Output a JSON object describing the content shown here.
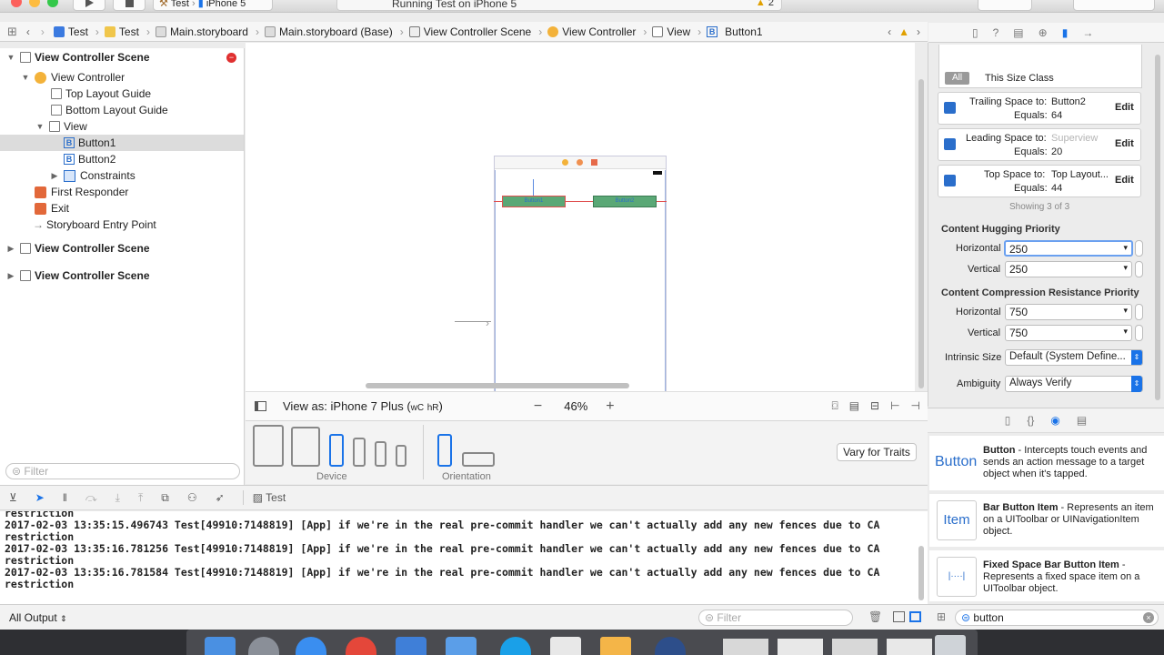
{
  "toolbar": {
    "scheme_target": "Test",
    "scheme_device": "iPhone 5",
    "status_text": "Running Test on iPhone 5",
    "warning_count": "2"
  },
  "jumpbar": [
    "Test",
    "Test",
    "Main.storyboard",
    "Main.storyboard (Base)",
    "View Controller Scene",
    "View Controller",
    "View",
    "Button1"
  ],
  "navigator": {
    "items": [
      {
        "label": "View Controller Scene",
        "bold": true
      },
      {
        "label": "View Controller"
      },
      {
        "label": "Top Layout Guide"
      },
      {
        "label": "Bottom Layout Guide"
      },
      {
        "label": "View"
      },
      {
        "label": "Button1"
      },
      {
        "label": "Button2"
      },
      {
        "label": "Constraints"
      },
      {
        "label": "First Responder"
      },
      {
        "label": "Exit"
      },
      {
        "label": "Storyboard Entry Point"
      },
      {
        "label": "View Controller Scene",
        "bold": true
      },
      {
        "label": "View Controller Scene",
        "bold": true
      }
    ],
    "filter_placeholder": "Filter"
  },
  "canvas": {
    "view_as": "View as: iPhone 7 Plus (",
    "size_class_w": "wC",
    "size_class_h": "hR",
    "view_as_end": ")",
    "zoom": "46%",
    "device_label": "Device",
    "orientation_label": "Orientation",
    "vary_button": "Vary for Traits",
    "button1": "Button1",
    "button2": "Button2"
  },
  "inspector": {
    "tab_all": "All",
    "tab_size_class": "This Size Class",
    "constraints": [
      {
        "title": "Trailing Space to:",
        "target": "Button2",
        "equals_label": "Equals:",
        "value": "64",
        "edit": "Edit",
        "dim": false
      },
      {
        "title": "Leading Space to:",
        "target": "Superview",
        "equals_label": "Equals:",
        "value": "20",
        "edit": "Edit",
        "dim": true
      },
      {
        "title": "Top Space to:",
        "target": "Top Layout...",
        "equals_label": "Equals:",
        "value": "44",
        "edit": "Edit",
        "dim": false
      }
    ],
    "showing": "Showing 3 of 3",
    "hugging_title": "Content Hugging Priority",
    "hugging_h_label": "Horizontal",
    "hugging_h": "250",
    "hugging_v_label": "Vertical",
    "hugging_v": "250",
    "compression_title": "Content Compression Resistance Priority",
    "comp_h_label": "Horizontal",
    "comp_h": "750",
    "comp_v_label": "Vertical",
    "comp_v": "750",
    "intrinsic_label": "Intrinsic Size",
    "intrinsic_value": "Default (System Define...",
    "ambiguity_label": "Ambiguity",
    "ambiguity_value": "Always Verify"
  },
  "library": {
    "items": [
      {
        "icon_text": "Button",
        "name": "Button",
        "desc": " - Intercepts touch events and sends an action message to a target object when it's tapped."
      },
      {
        "icon_text": "Item",
        "name": "Bar Button Item",
        "desc": " - Represents an item on a UIToolbar or UINavigationItem object."
      },
      {
        "icon_text": "",
        "name": "Fixed Space Bar Button Item",
        "desc": " - Represents a fixed space item on a UIToolbar object."
      }
    ],
    "search_value": "button"
  },
  "debug": {
    "target": "Test",
    "console_lines": [
      "restriction",
      "2017-02-03 13:35:15.496743 Test[49910:7148819] [App] if we're in the real pre-commit handler we can't actually add any new fences due to CA",
      "restriction",
      "2017-02-03 13:35:16.781256 Test[49910:7148819] [App] if we're in the real pre-commit handler we can't actually add any new fences due to CA",
      "restriction",
      "2017-02-03 13:35:16.781584 Test[49910:7148819] [App] if we're in the real pre-commit handler we can't actually add any new fences due to CA",
      "restriction"
    ],
    "output_select": "All Output",
    "filter_placeholder": "Filter"
  },
  "colors": {
    "accent": "#1a73e8",
    "button_fill": "#5aa876",
    "constraint": "#e05050"
  }
}
